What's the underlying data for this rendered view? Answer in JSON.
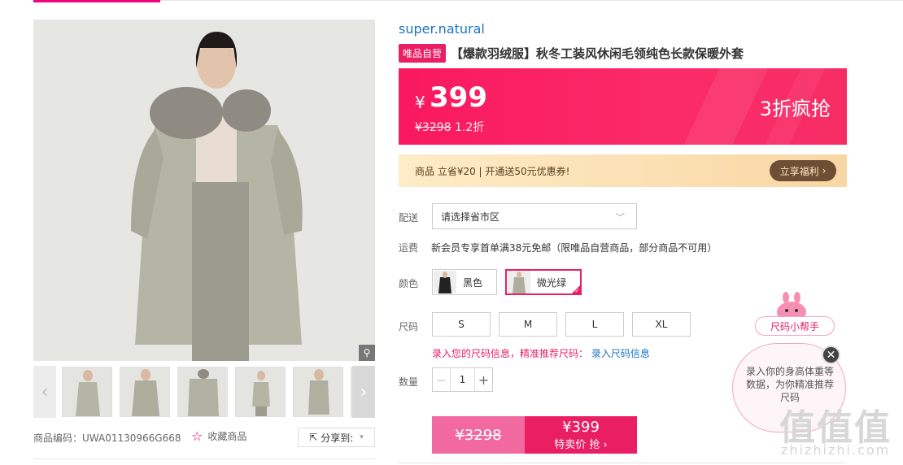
{
  "product": {
    "brand": "super.natural",
    "self_tag": "唯品自营",
    "title": "【爆款羽绒服】秋冬工装风休闲毛领纯色长款保暖外套",
    "sku_label": "商品编码：UWA01130966G668",
    "favorite_label": "收藏商品",
    "share_label": "分享到:"
  },
  "price": {
    "currency": "¥",
    "current": "399",
    "original": "¥3298",
    "discount": "1.2折",
    "promo": "3折疯抢"
  },
  "coupon": {
    "text": "商品 立省¥20 | 开通送50元优惠券!",
    "button": "立享福利"
  },
  "delivery": {
    "label": "配送",
    "placeholder": "请选择省市区"
  },
  "shipping": {
    "label": "运费",
    "text": "新会员专享首单满38元免邮（限唯品自营商品，部分商品不可用）"
  },
  "color": {
    "label": "颜色",
    "options": [
      "黑色",
      "微光绿"
    ],
    "selected": "微光绿"
  },
  "size": {
    "label": "尺码",
    "options": [
      "S",
      "M",
      "L",
      "XL"
    ],
    "info_text": "录入您的尺码信息，精准推荐尺码：",
    "info_link": "录入尺码信息"
  },
  "quantity": {
    "label": "数量",
    "value": "1"
  },
  "buy": {
    "original": "¥3298",
    "price": "¥399",
    "label": "特卖价 抢"
  },
  "helper": {
    "tag": "尺码小帮手",
    "text": "录入你的身高体重等数据，为你精准推荐尺码"
  },
  "watermark": {
    "main": "值值值",
    "sub": "zhizhizhi.com"
  },
  "colors": {
    "accent": "#e91e63",
    "banner": "#f9185f",
    "link": "#1a73c5"
  }
}
